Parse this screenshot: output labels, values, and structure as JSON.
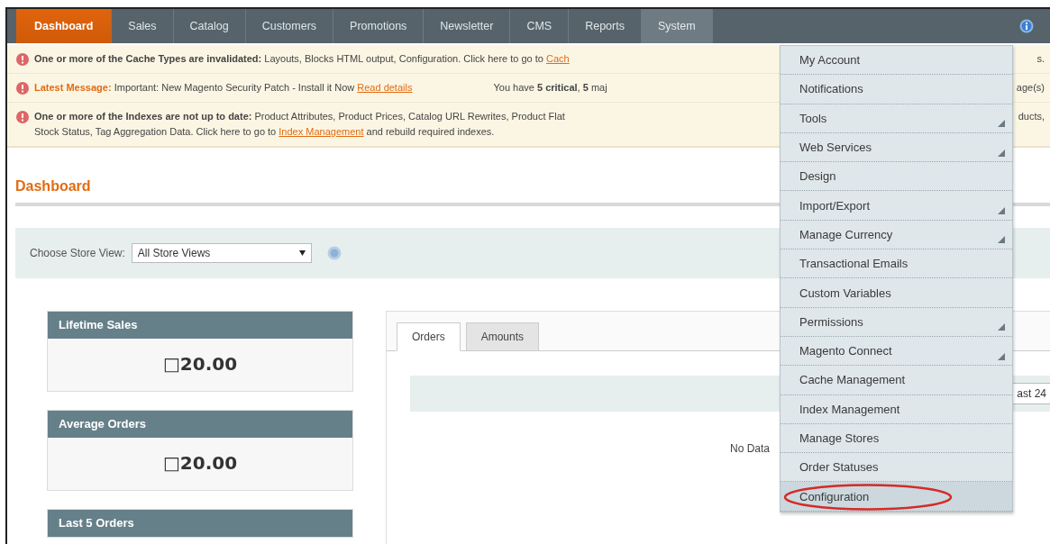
{
  "nav": {
    "items": [
      {
        "label": "Dashboard",
        "selected": true
      },
      {
        "label": "Sales",
        "selected": false
      },
      {
        "label": "Catalog",
        "selected": false
      },
      {
        "label": "Customers",
        "selected": false
      },
      {
        "label": "Promotions",
        "selected": false
      },
      {
        "label": "Newsletter",
        "selected": false
      },
      {
        "label": "CMS",
        "selected": false
      },
      {
        "label": "Reports",
        "selected": false
      },
      {
        "label": "System",
        "selected": false,
        "open": true
      }
    ]
  },
  "alerts": [
    {
      "kind": "single",
      "title": "One or more of the Cache Types are invalidated:",
      "text": "Layouts, Blocks HTML output, Configuration. Click here to go to",
      "link": "Cach",
      "tail": "s."
    },
    {
      "kind": "message",
      "title": "Latest Message:",
      "text": "Important: New Magento Security Patch - Install it Now",
      "link": "Read details",
      "summary": "You have **5 critical**, **5** maj",
      "tail": "age(s)"
    },
    {
      "kind": "double",
      "title": "One or more of the Indexes are not up to date:",
      "text": "Product Attributes, Product Prices, Catalog URL Rewrites, Product Flat",
      "tail": "ducts,",
      "line2": "Stock Status, Tag Aggregation Data. Click here to go to",
      "link": "Index Management",
      "line2_end": "and rebuild required indexes."
    }
  ],
  "page_title": "Dashboard",
  "store_view": {
    "label": "Choose Store View:",
    "value": "All Store Views"
  },
  "cards": [
    {
      "title": "Lifetime Sales",
      "value": "□20.00"
    },
    {
      "title": "Average Orders",
      "value": "□20.00"
    },
    {
      "title": "Last 5 Orders"
    }
  ],
  "chart_panel": {
    "tabs": [
      {
        "label": "Orders",
        "selected": true
      },
      {
        "label": "Amounts",
        "selected": false
      }
    ],
    "period": "ast 24",
    "empty": "No Data"
  },
  "system_menu": [
    {
      "label": "My Account",
      "submenu": false,
      "selected": false
    },
    {
      "label": "Notifications",
      "submenu": false,
      "selected": false
    },
    {
      "label": "Tools",
      "submenu": true,
      "selected": false
    },
    {
      "label": "Web Services",
      "submenu": true,
      "selected": false
    },
    {
      "label": "Design",
      "submenu": false,
      "selected": false
    },
    {
      "label": "Import/Export",
      "submenu": true,
      "selected": false
    },
    {
      "label": "Manage Currency",
      "submenu": true,
      "selected": false
    },
    {
      "label": "Transactional Emails",
      "submenu": false,
      "selected": false
    },
    {
      "label": "Custom Variables",
      "submenu": false,
      "selected": false
    },
    {
      "label": "Permissions",
      "submenu": true,
      "selected": false
    },
    {
      "label": "Magento Connect",
      "submenu": true,
      "selected": false
    },
    {
      "label": "Cache Management",
      "submenu": false,
      "selected": false
    },
    {
      "label": "Index Management",
      "submenu": false,
      "selected": false
    },
    {
      "label": "Manage Stores",
      "submenu": false,
      "selected": false
    },
    {
      "label": "Order Statuses",
      "submenu": false,
      "selected": false
    },
    {
      "label": "Configuration",
      "submenu": false,
      "selected": true,
      "circled": true
    }
  ]
}
